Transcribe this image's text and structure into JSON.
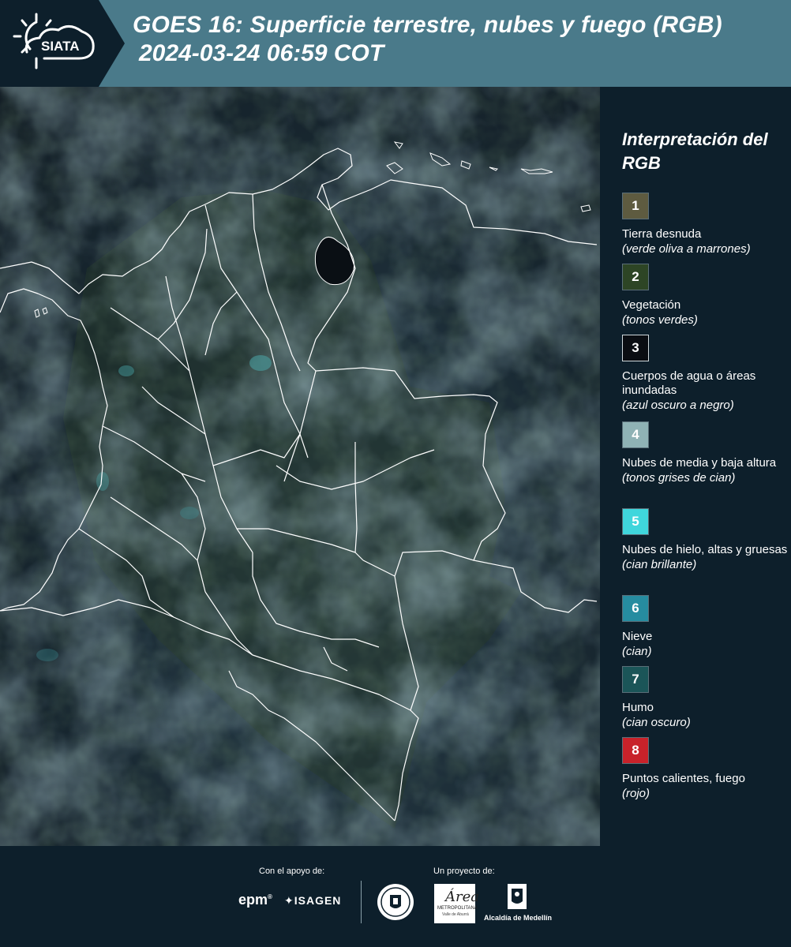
{
  "header": {
    "logo_text": "SIATA",
    "title": "GOES 16: Superficie terrestre, nubes y fuego (RGB)",
    "datetime": "2024-03-24 06:59 COT"
  },
  "legend": {
    "title": "Interpretación del RGB",
    "items": [
      {
        "number": "1",
        "label": "Tierra desnuda",
        "note": "(verde oliva a marrones)",
        "color": "#5e5b40"
      },
      {
        "number": "2",
        "label": "Vegetación",
        "note": "(tonos verdes)",
        "color": "#2d4525"
      },
      {
        "number": "3",
        "label": "Cuerpos de agua o áreas inundadas",
        "note": "(azul oscuro a negro)",
        "color": "#0a0d12"
      },
      {
        "number": "4",
        "label": "Nubes de media y baja altura",
        "note": "(tonos grises de cian)",
        "color": "#8fb2b5"
      },
      {
        "number": "5",
        "label": "Nubes de hielo, altas y gruesas",
        "note": "(cian brillante)",
        "color": "#3fd6dc"
      },
      {
        "number": "6",
        "label": "Nieve",
        "note": "(cian)",
        "color": "#268ca0"
      },
      {
        "number": "7",
        "label": "Humo",
        "note": "(cian oscuro)",
        "color": "#1b5558"
      },
      {
        "number": "8",
        "label": "Puntos calientes, fuego",
        "note": "(rojo)",
        "color": "#c8222a"
      }
    ]
  },
  "footer": {
    "support_label": "Con el apoyo de:",
    "project_label": "Un proyecto de:",
    "sponsor_epm": "epm",
    "sponsor_isagen": "ISAGEN",
    "partner_area": "METROPOLITANA",
    "partner_alcaldia": "Alcaldía de Medellín"
  }
}
